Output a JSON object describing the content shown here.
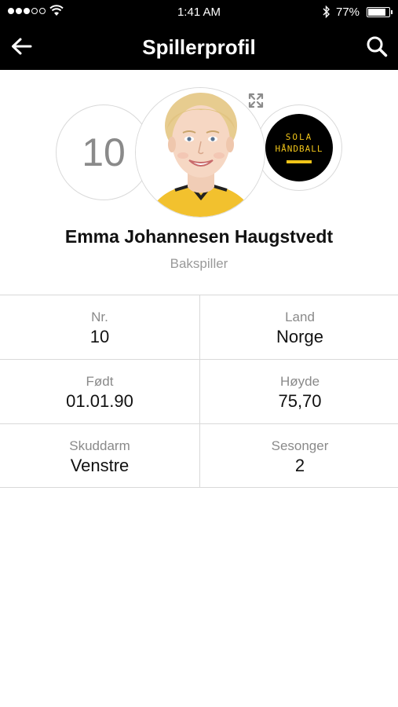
{
  "status_bar": {
    "time": "1:41 AM",
    "battery_percent": "77%",
    "battery_level": 0.77,
    "signal_bars": 3,
    "icons": [
      "signal-dots-icon",
      "wifi-icon",
      "bluetooth-icon",
      "battery-icon"
    ]
  },
  "header": {
    "title": "Spillerprofil",
    "back_icon": "arrow-left-icon",
    "search_icon": "search-icon",
    "background": "#000000",
    "text_color": "#ffffff"
  },
  "profile": {
    "number": "10",
    "name": "Emma Johannesen Haugstvedt",
    "position": "Bakspiller",
    "expand_icon": "expand-arrows-icon",
    "club_logo": {
      "line1": "SOLA",
      "line2": "HÅNDBALL",
      "color": "#f0c419",
      "background": "#000000"
    }
  },
  "info": [
    {
      "left": {
        "label": "Nr.",
        "value": "10"
      },
      "right": {
        "label": "Land",
        "value": "Norge"
      }
    },
    {
      "left": {
        "label": "Født",
        "value": "01.01.90"
      },
      "right": {
        "label": "Høyde",
        "value": "75,70"
      }
    },
    {
      "left": {
        "label": "Skuddarm",
        "value": "Venstre"
      },
      "right": {
        "label": "Sesonger",
        "value": "2"
      }
    }
  ]
}
